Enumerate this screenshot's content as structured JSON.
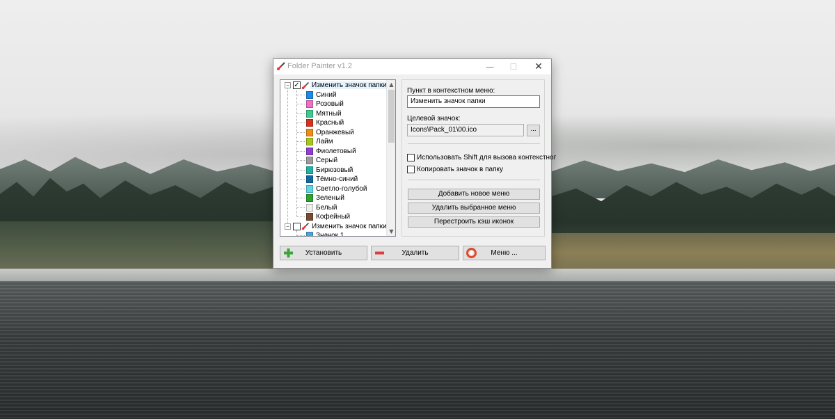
{
  "window": {
    "title": "Folder Painter v1.2",
    "minimize": "—",
    "maximize": "☐",
    "close": "✕"
  },
  "tree": {
    "groups": [
      {
        "label": "Изменить значок папки",
        "checked": true,
        "expanded": true,
        "children": [
          {
            "label": "Синий",
            "color": "#1e88e5"
          },
          {
            "label": "Розовый",
            "color": "#f06fc3"
          },
          {
            "label": "Мятный",
            "color": "#3ec98f"
          },
          {
            "label": "Красный",
            "color": "#d8301f"
          },
          {
            "label": "Оранжевый",
            "color": "#f08c13"
          },
          {
            "label": "Лайм",
            "color": "#a6c81a"
          },
          {
            "label": "Фиолетовый",
            "color": "#8e3fd1"
          },
          {
            "label": "Серый",
            "color": "#9b9b9b"
          },
          {
            "label": "Бирюзовый",
            "color": "#1eb3a6"
          },
          {
            "label": "Тёмно-синий",
            "color": "#0f6aa3"
          },
          {
            "label": "Светло-голубой",
            "color": "#5fd7e8"
          },
          {
            "label": "Зеленый",
            "color": "#2fa32f"
          },
          {
            "label": "Белый",
            "color": "#eeeeee"
          },
          {
            "label": "Кофейный",
            "color": "#7a4b2e"
          }
        ]
      },
      {
        "label": "Изменить значок папки",
        "checked": false,
        "expanded": true,
        "children": [
          {
            "label": "Значок 1",
            "color": "#4aa3df"
          }
        ]
      }
    ]
  },
  "settings": {
    "menu_item_label": "Пункт в контекстном меню:",
    "menu_item_value": "Изменить значок папки",
    "target_icon_label": "Целевой значок:",
    "target_icon_value": "Icons\\Pack_01\\00.ico",
    "browse_label": "...",
    "shift_checkbox": "Использовать Shift для вызова контекстног",
    "copy_checkbox": "Копировать значок в папку",
    "add_menu_button": "Добавить новое меню",
    "delete_menu_button": "Удалить выбранное меню",
    "rebuild_cache_button": "Перестроить кэш иконок"
  },
  "actions": {
    "install": "Установить",
    "remove": "Удалить",
    "menu": "Меню ..."
  },
  "colors": {
    "install_icon": "#3aa53a",
    "remove_icon": "#e03c3c",
    "menu_icon": "#e04a2a"
  }
}
